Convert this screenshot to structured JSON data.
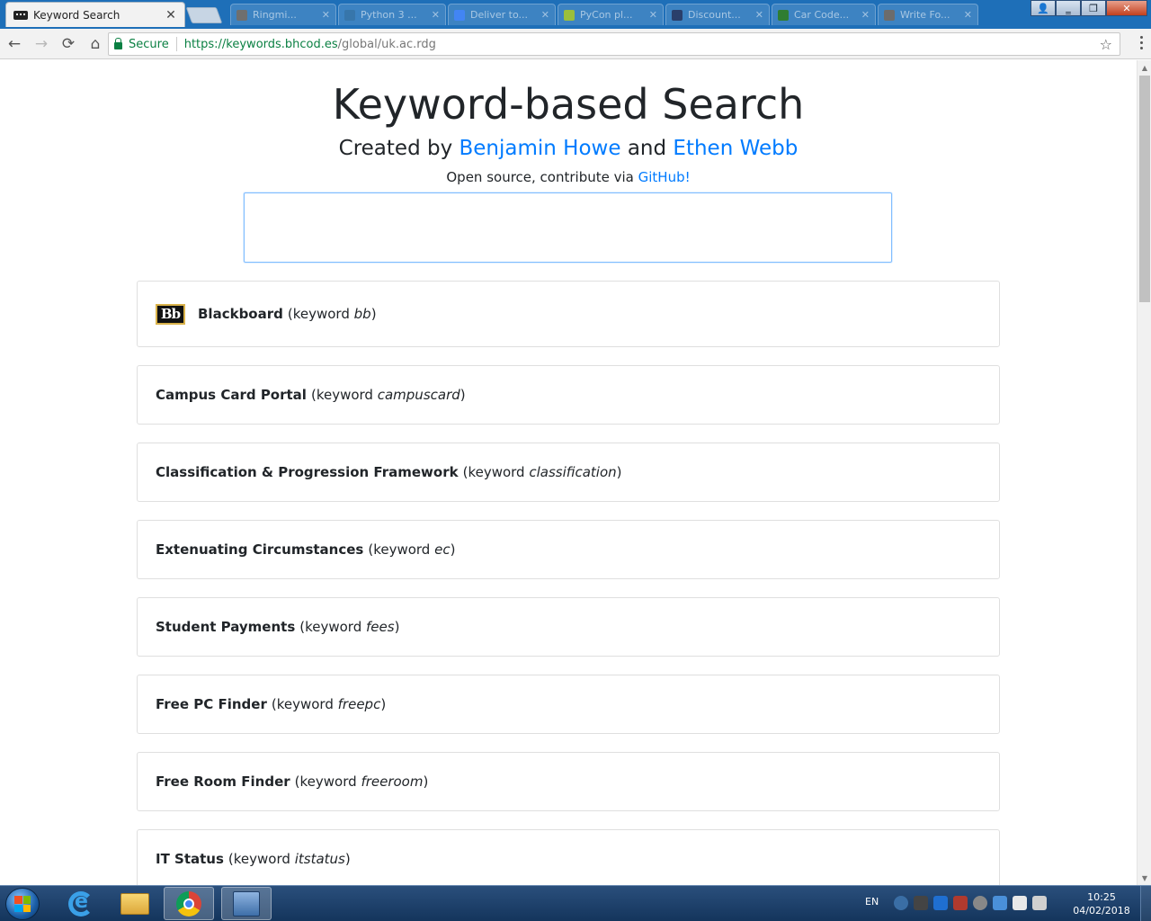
{
  "browser": {
    "active_tab": {
      "title": "Keyword Search",
      "close": "✕"
    },
    "background_tabs": [
      {
        "label": "Ringmi...",
        "color": "#6f6f6f"
      },
      {
        "label": "Python 3 ...",
        "color": "#3776ab"
      },
      {
        "label": "Deliver to...",
        "color": "#4285f4"
      },
      {
        "label": "PyCon pl...",
        "color": "#9bbf3c"
      },
      {
        "label": "Discount...",
        "color": "#2a3f6b"
      },
      {
        "label": "Car Code...",
        "color": "#2f7d32"
      },
      {
        "label": "Write Fo...",
        "color": "#6c6c6c"
      }
    ],
    "toolbar": {
      "back_icon": "←",
      "forward_icon": "→",
      "reload_icon": "⟳",
      "home_icon": "⌂",
      "secure_label": "Secure",
      "url_domain": "https://keywords.bhcod.es",
      "url_path": "/global/uk.ac.rdg",
      "star_icon": "☆"
    },
    "window_controls": {
      "minimize": "‗",
      "restore": "❐",
      "close": "✕"
    }
  },
  "page": {
    "title": "Keyword-based Search",
    "created_prefix": "Created by ",
    "author1": "Benjamin Howe",
    "and": " and ",
    "author2": "Ethen Webb",
    "open_source_prefix": "Open source, contribute via ",
    "github": "GitHub!",
    "search_value": "",
    "search_placeholder": ""
  },
  "logo_text": "Bb",
  "keyword_word": "keyword",
  "results": [
    {
      "name": "Blackboard",
      "keyword": "bb"
    },
    {
      "name": "Campus Card Portal",
      "keyword": "campuscard"
    },
    {
      "name": "Classification & Progression Framework",
      "keyword": "classification"
    },
    {
      "name": "Extenuating Circumstances",
      "keyword": "ec"
    },
    {
      "name": "Student Payments",
      "keyword": "fees"
    },
    {
      "name": "Free PC Finder",
      "keyword": "freepc"
    },
    {
      "name": "Free Room Finder",
      "keyword": "freeroom"
    },
    {
      "name": "IT Status",
      "keyword": "itstatus"
    }
  ],
  "taskbar": {
    "language": "EN",
    "time": "10:25",
    "date": "04/02/2018"
  },
  "colors": {
    "link": "#007bff",
    "secure_green": "#0b8043",
    "tab_strip": "#1e6fb8"
  }
}
